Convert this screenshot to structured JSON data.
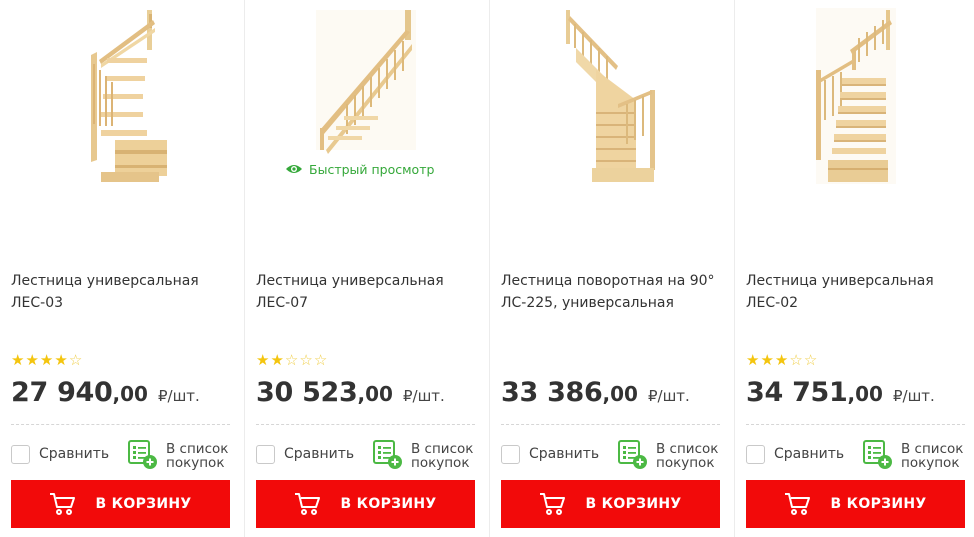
{
  "quick_view_label": "Быстрый просмотр",
  "colors": {
    "accent_red": "#f20a0a",
    "green": "#35a83a",
    "star": "#f4c50f"
  },
  "products": [
    {
      "title_line1": "Лестница универсальная",
      "title_line2": "ЛЕС-03",
      "rating": 4,
      "rating_max": 5,
      "price_int": "27 940",
      "price_dec": ",00",
      "price_unit": "₽/шт.",
      "compare_label": "Сравнить",
      "shoplist_line1": "В список",
      "shoplist_line2": "покупок",
      "cart_label": "В КОРЗИНУ"
    },
    {
      "title_line1": "Лестница универсальная",
      "title_line2": "ЛЕС-07",
      "rating": 2,
      "rating_max": 5,
      "price_int": "30 523",
      "price_dec": ",00",
      "price_unit": "₽/шт.",
      "compare_label": "Сравнить",
      "shoplist_line1": "В список",
      "shoplist_line2": "покупок",
      "cart_label": "В КОРЗИНУ"
    },
    {
      "title_line1": "Лестница поворотная на 90°",
      "title_line2": "ЛС-225, универсальная",
      "rating": 0,
      "rating_max": 0,
      "price_int": "33 386",
      "price_dec": ",00",
      "price_unit": "₽/шт.",
      "compare_label": "Сравнить",
      "shoplist_line1": "В список",
      "shoplist_line2": "покупок",
      "cart_label": "В КОРЗИНУ"
    },
    {
      "title_line1": "Лестница универсальная",
      "title_line2": "ЛЕС-02",
      "rating": 3,
      "rating_max": 5,
      "price_int": "34 751",
      "price_dec": ",00",
      "price_unit": "₽/шт.",
      "compare_label": "Сравнить",
      "shoplist_line1": "В список",
      "shoplist_line2": "покупок",
      "cart_label": "В КОРЗИНУ"
    }
  ]
}
